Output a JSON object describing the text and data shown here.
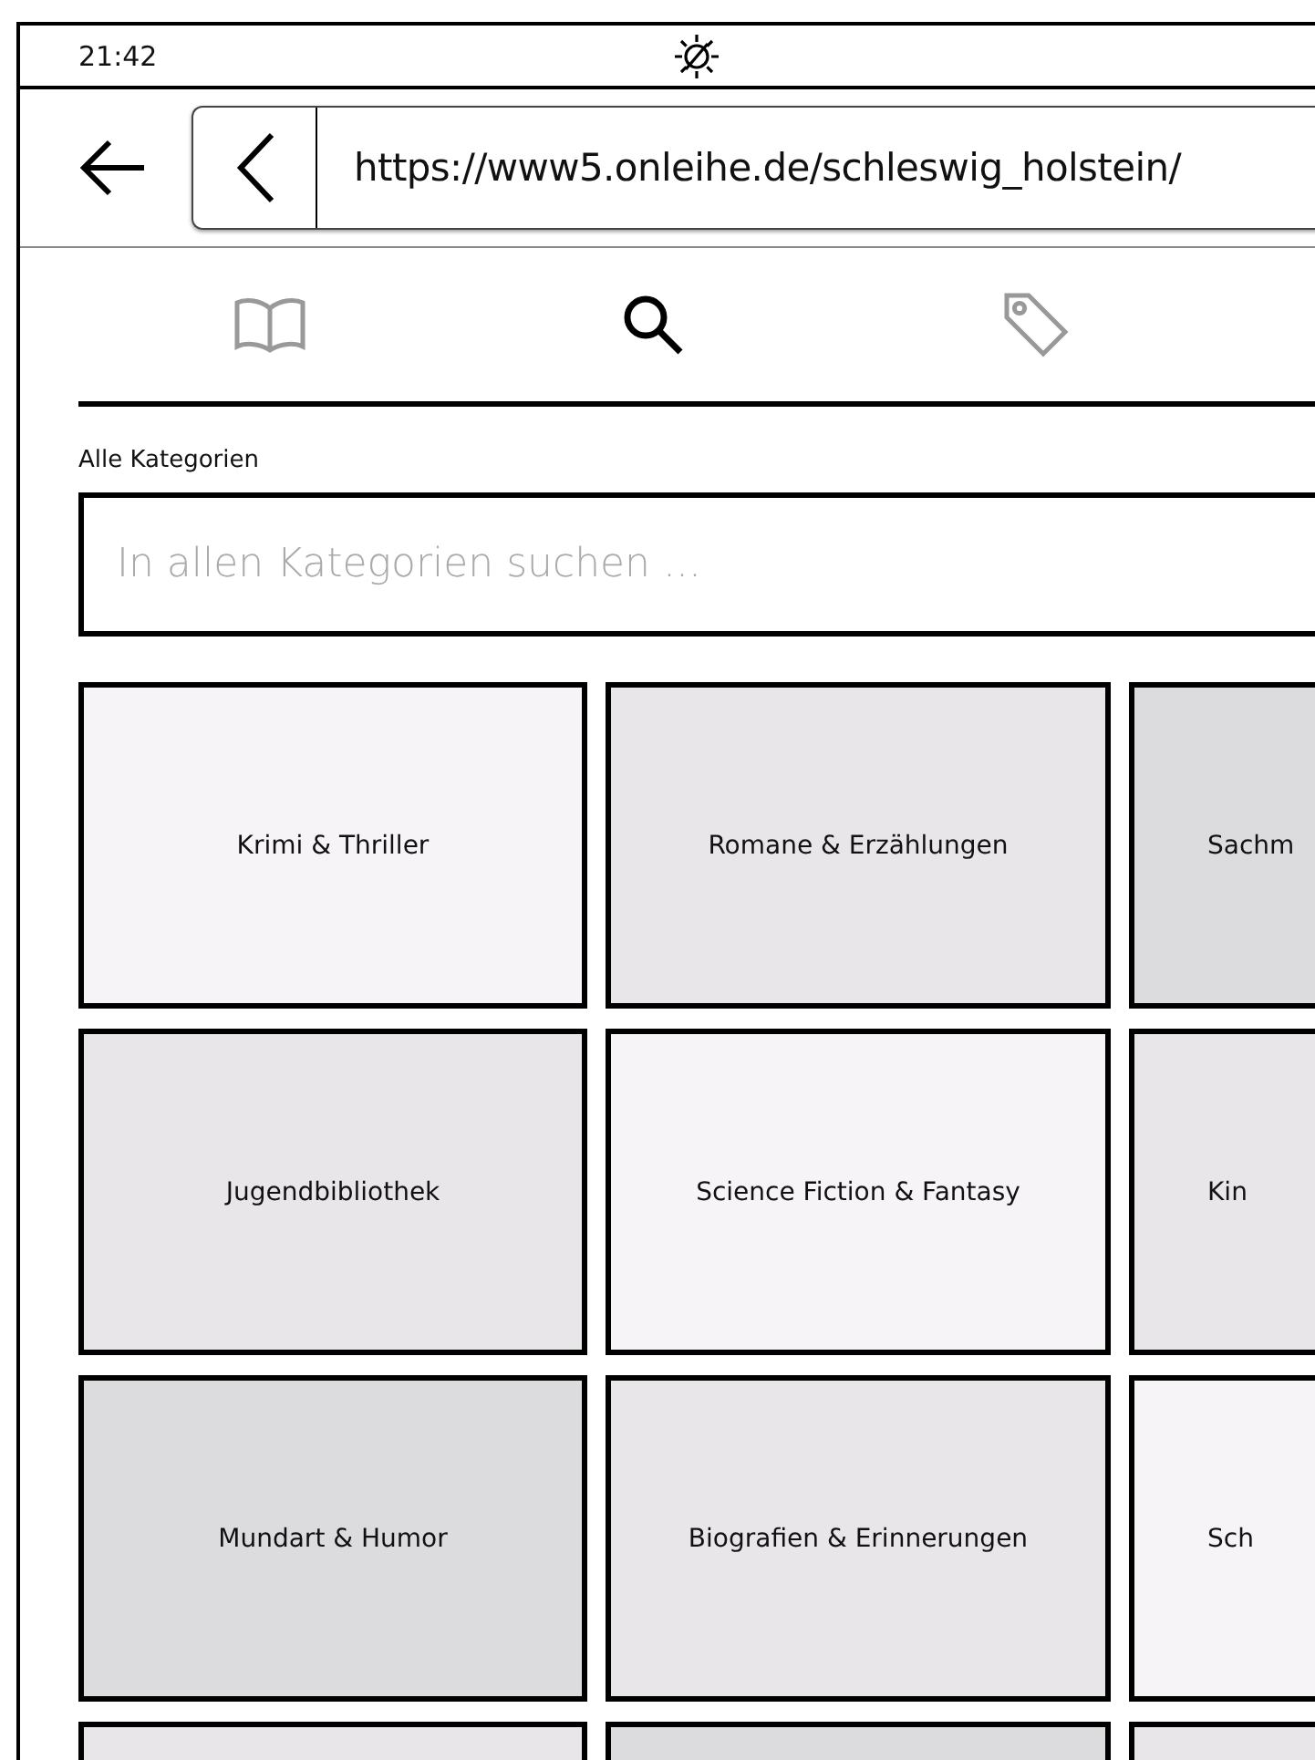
{
  "status_bar": {
    "time": "21:42"
  },
  "toolbar": {
    "url": "https://www5.onleihe.de/schleswig_holstein/"
  },
  "tabs": [
    {
      "kind": "book",
      "selected": false
    },
    {
      "kind": "search",
      "selected": true
    },
    {
      "kind": "tag",
      "selected": false
    }
  ],
  "search": {
    "label": "Alle Kategorien",
    "placeholder": "In allen Kategorien suchen ..."
  },
  "categories": [
    {
      "label": "Krimi & Thriller",
      "color": "#f7f4f7"
    },
    {
      "label": "Romane & Erzählungen",
      "color": "#e9e6ea"
    },
    {
      "label": "Sachm",
      "color": "#dcdbde"
    },
    {
      "label": "Jugendbibliothek",
      "color": "#e9e6ea"
    },
    {
      "label": "Science Fiction & Fantasy",
      "color": "#f7f4f7"
    },
    {
      "label": "Kin",
      "color": "#e9e6ea"
    },
    {
      "label": "Mundart & Humor",
      "color": "#dcdbde"
    },
    {
      "label": "Biografien & Erinnerungen",
      "color": "#e9e6ea"
    },
    {
      "label": "Sch",
      "color": "#f7f4f7"
    },
    {
      "color": "#e9e6ea"
    },
    {
      "color": "#dcdbde"
    },
    {
      "color": "#e9e6ea"
    }
  ]
}
